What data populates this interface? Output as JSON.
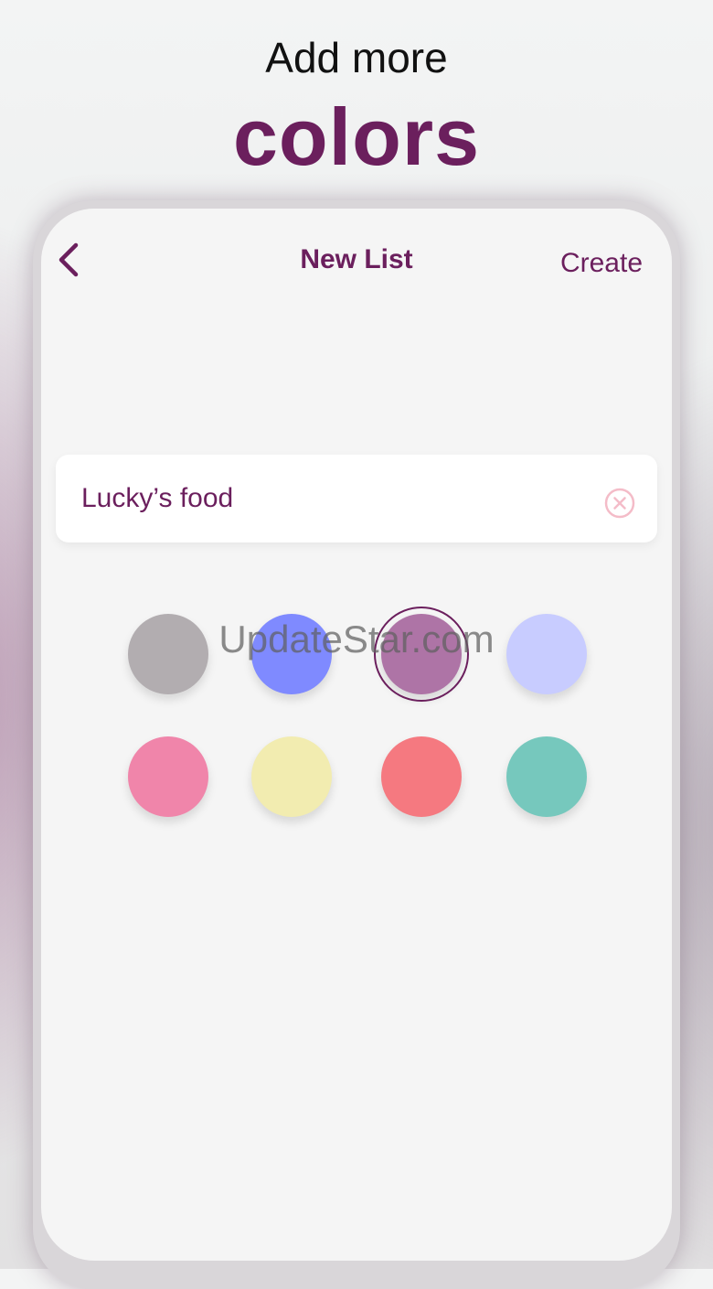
{
  "promo": {
    "headline_top": "Add more",
    "headline_big": "colors"
  },
  "nav": {
    "back_icon": "chevron-left-icon",
    "title": "New List",
    "create_label": "Create"
  },
  "list_name": {
    "value": "Lucky’s food",
    "clear_icon": "clear-circle-icon"
  },
  "palette": {
    "selected_index": 2,
    "colors": [
      {
        "name": "gray",
        "hex": "#b2adb0"
      },
      {
        "name": "blue",
        "hex": "#7f8aff"
      },
      {
        "name": "purple",
        "hex": "#ae74a6"
      },
      {
        "name": "lavender",
        "hex": "#c8ccff"
      },
      {
        "name": "pink",
        "hex": "#f085aa"
      },
      {
        "name": "yellow",
        "hex": "#f2ecb0"
      },
      {
        "name": "red",
        "hex": "#f57980"
      },
      {
        "name": "teal",
        "hex": "#76c8bd"
      }
    ]
  },
  "watermark": "UpdateStar.com",
  "theme": {
    "accent": "#6b1f5d",
    "background": "#f5f5f5",
    "clear_icon_color": "#f4bcc8"
  }
}
